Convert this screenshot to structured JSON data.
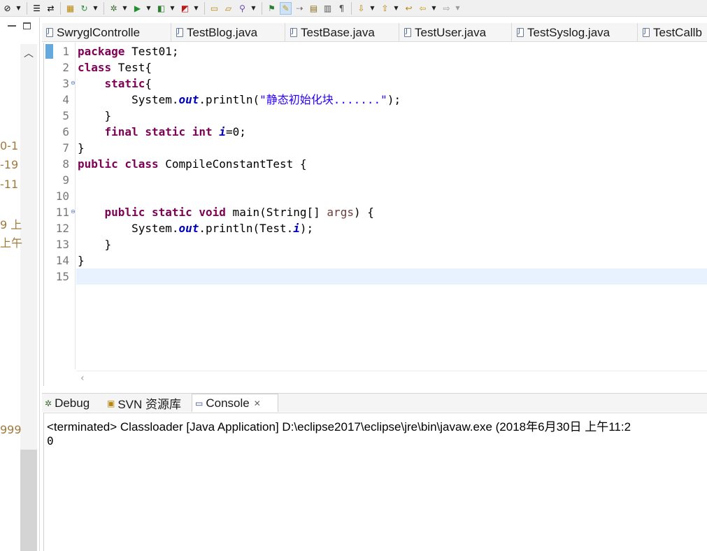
{
  "toolbar": {
    "icons": [
      "skip-all-breakpoints-icon",
      "link-with-editor-icon",
      "new-java-package-icon",
      "refresh-icon",
      "debug-icon",
      "run-icon",
      "coverage-icon",
      "external-tools-icon",
      "open-type-icon",
      "open-task-icon",
      "search-icon",
      "toggle-breadcrumb-icon",
      "toggle-mark-occurrences-icon",
      "toggle-word-wrap-icon",
      "block-selection-icon",
      "show-whitespace-icon",
      "next-annotation-icon",
      "previous-annotation-icon",
      "last-edit-location-icon",
      "back-icon",
      "forward-icon"
    ]
  },
  "left_panel": {
    "fragments": [
      "0-1",
      "-19",
      "-11",
      "9 上",
      "上午",
      "999"
    ]
  },
  "editor_tabs": [
    {
      "label": "SwryglControlle"
    },
    {
      "label": "TestBlog.java"
    },
    {
      "label": "TestBase.java"
    },
    {
      "label": "TestUser.java"
    },
    {
      "label": "TestSyslog.java"
    },
    {
      "label": "TestCallb"
    }
  ],
  "editor": {
    "line_numbers": [
      "1",
      "2",
      "3",
      "4",
      "5",
      "6",
      "7",
      "8",
      "9",
      "10",
      "11",
      "12",
      "13",
      "14",
      "15"
    ],
    "folded_lines": [
      "3",
      "11"
    ],
    "current_line": "15",
    "code": {
      "l1_kw": "package",
      "l1_rest": " Test01;",
      "l2_kw": "class",
      "l2_rest": " Test{",
      "l3_indent": "    ",
      "l3_kw": "static",
      "l3_rest": "{",
      "l4_indent": "        ",
      "l4_pre": "System.",
      "l4_fld": "out",
      "l4_mid": ".println(",
      "l4_str": "\"静态初始化块.......\"",
      "l4_end": ");",
      "l5_text": "    }",
      "l6_indent": "    ",
      "l6_kw": "final static int",
      "l6_sp": " ",
      "l6_fld": "i",
      "l6_rest": "=0;",
      "l7_text": "}",
      "l8_kw": "public class",
      "l8_rest": " CompileConstantTest {",
      "l11_indent": "    ",
      "l11_kw": "public static void",
      "l11_mid": " main(String[] ",
      "l11_arg": "args",
      "l11_end": ") {",
      "l12_indent": "        ",
      "l12_pre": "System.",
      "l12_fld": "out",
      "l12_mid": ".println(Test.",
      "l12_fld2": "i",
      "l12_end": ");",
      "l13_text": "    }",
      "l14_text": "}"
    }
  },
  "console_tabs": [
    {
      "label": "Debug",
      "icon": "debug-icon"
    },
    {
      "label": "SVN 资源库",
      "icon": "svn-repository-icon"
    },
    {
      "label": "Console",
      "icon": "console-icon",
      "active": true,
      "close": "✕"
    }
  ],
  "console": {
    "status": "<terminated> Classloader [Java Application] D:\\eclipse2017\\eclipse\\jre\\bin\\javaw.exe (2018年6月30日 上午11:2",
    "output": "0"
  }
}
